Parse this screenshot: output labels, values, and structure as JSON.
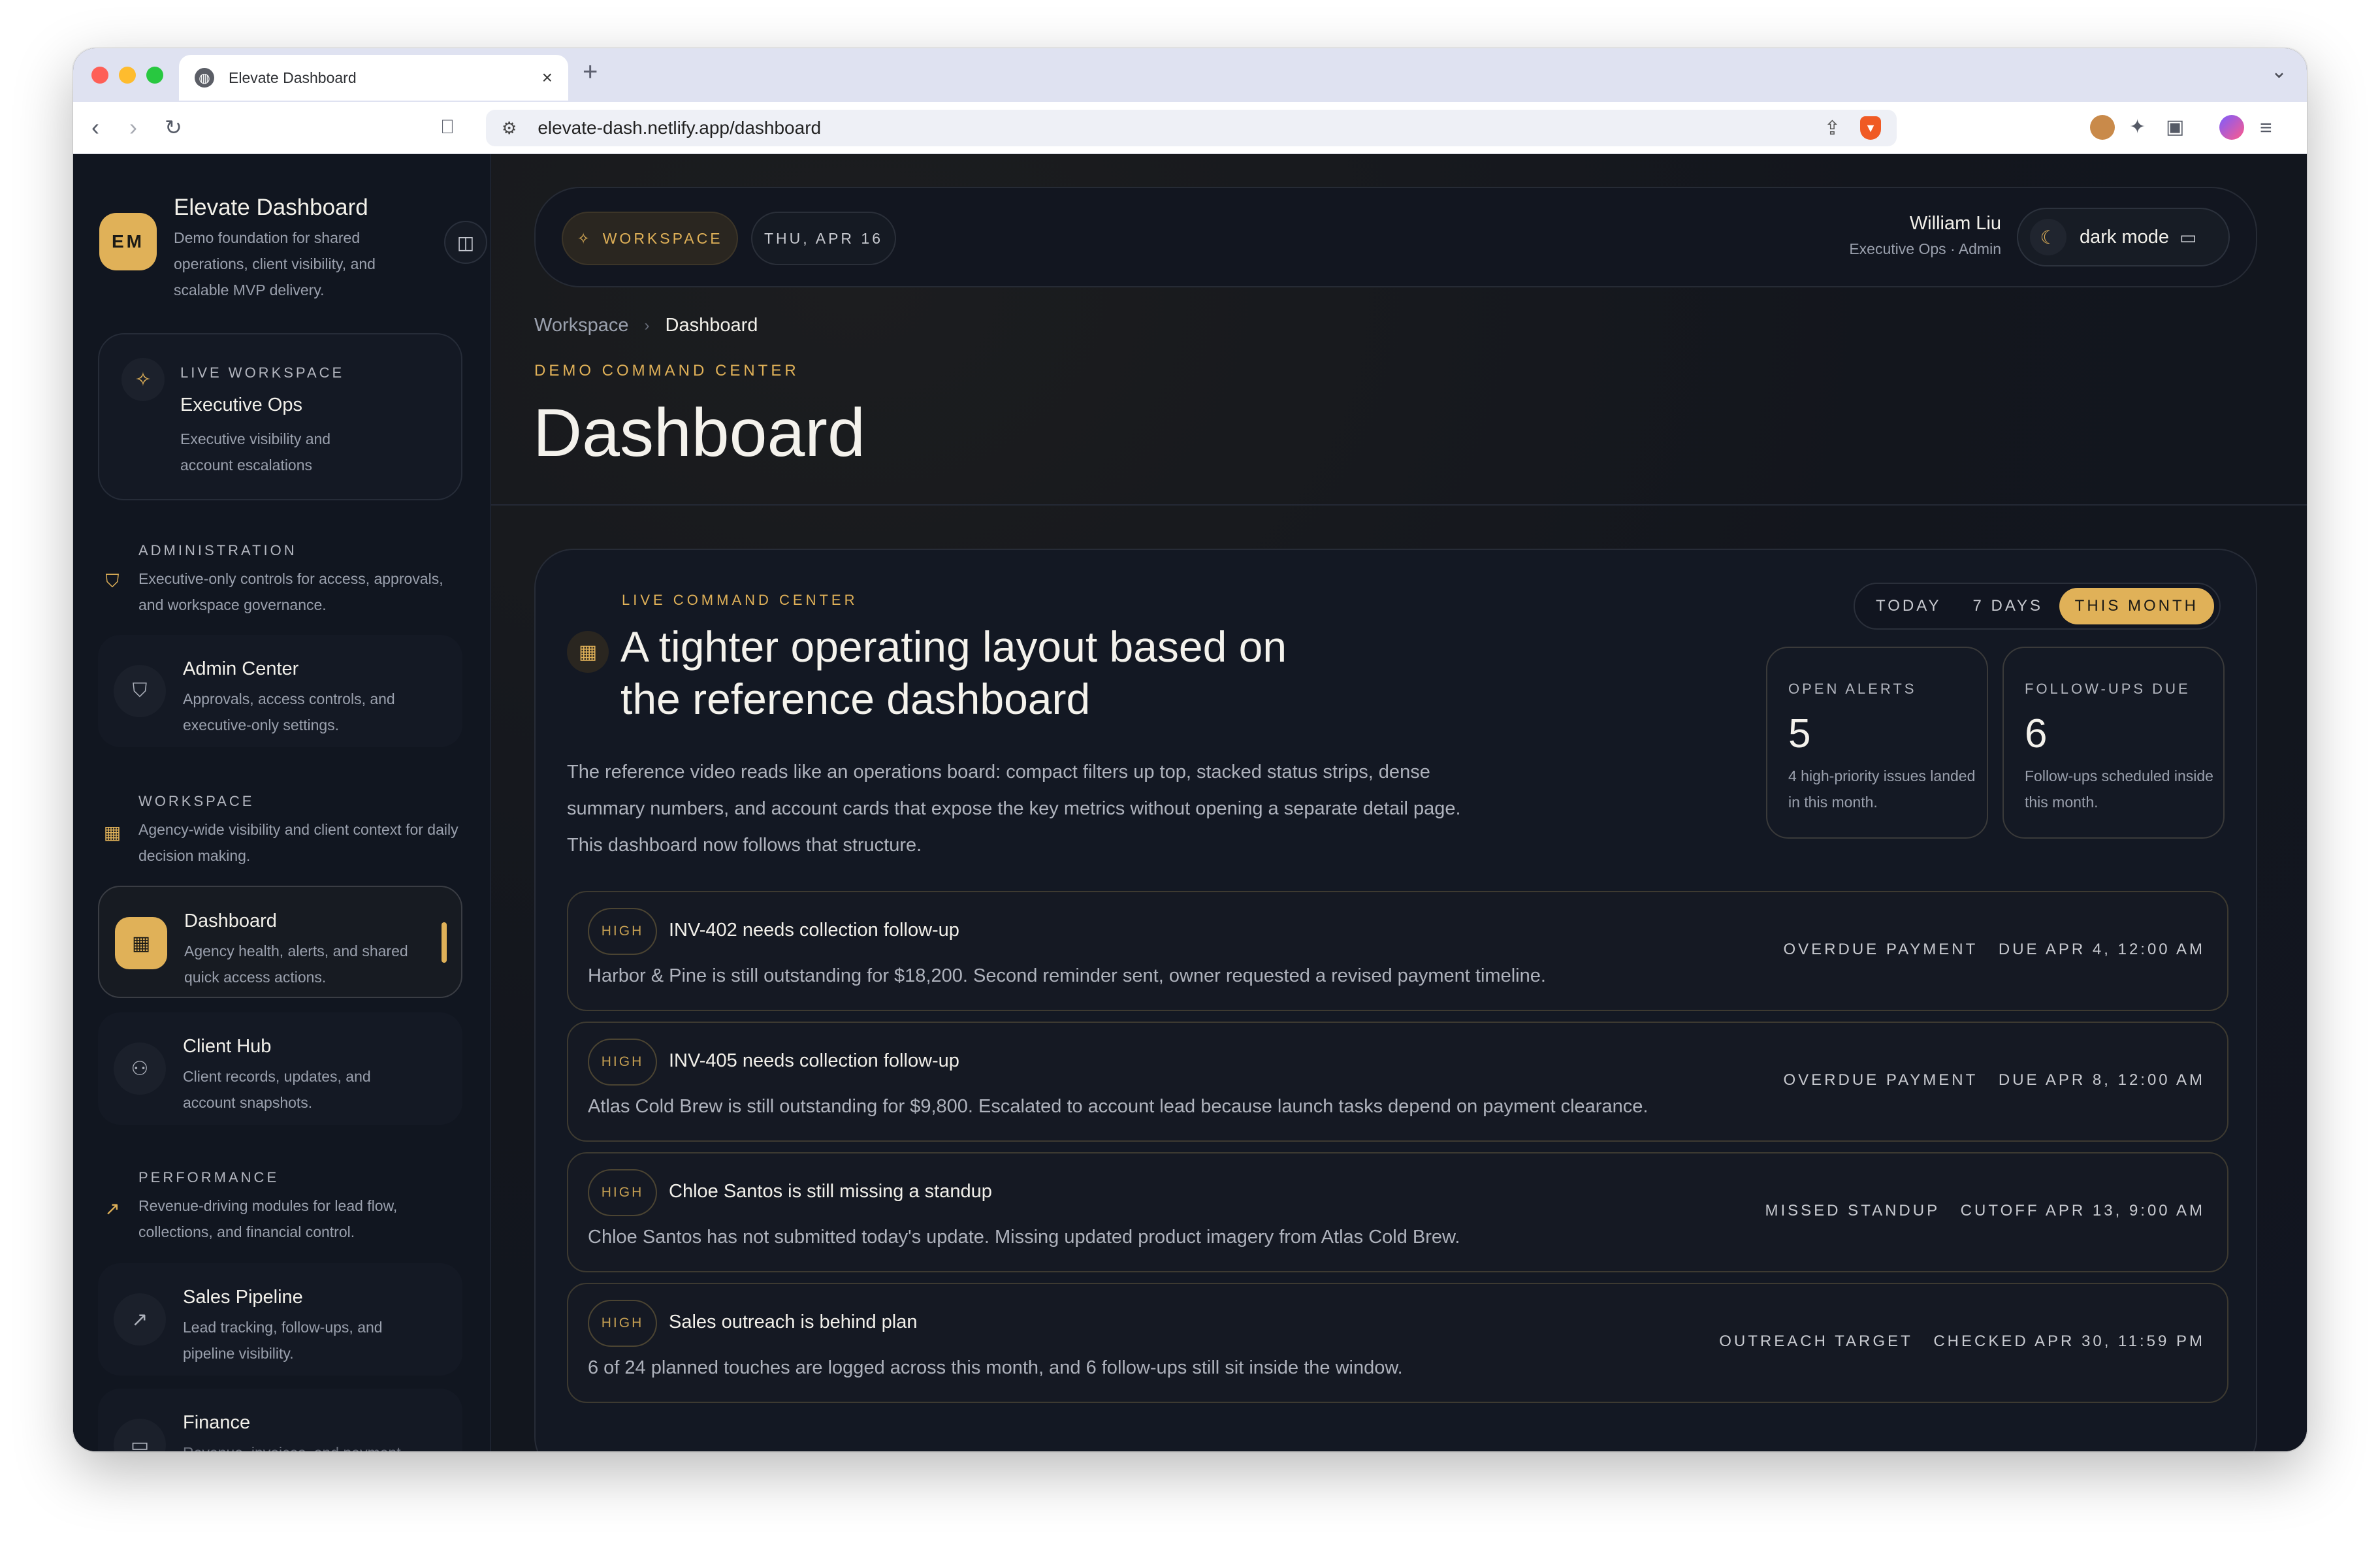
{
  "browser": {
    "tab_title": "Elevate Dashboard",
    "url": "elevate-dash.netlify.app/dashboard"
  },
  "sidebar": {
    "brand": {
      "initials": "EM",
      "name": "Elevate Dashboard",
      "description": "Demo foundation for shared operations, client visibility, and scalable MVP delivery."
    },
    "live_workspace": {
      "kicker": "LIVE WORKSPACE",
      "title": "Executive Ops",
      "subtitle": "Executive visibility and account escalations"
    },
    "sections": [
      {
        "kicker": "ADMINISTRATION",
        "description": "Executive-only controls for access, approvals, and workspace governance.",
        "icon": "shield-icon"
      },
      {
        "kicker": "WORKSPACE",
        "description": "Agency-wide visibility and client context for daily decision making.",
        "icon": "grid-icon"
      },
      {
        "kicker": "PERFORMANCE",
        "description": "Revenue-driving modules for lead flow, collections, and financial control.",
        "icon": "trend-icon"
      }
    ],
    "items": [
      {
        "title": "Admin Center",
        "subtitle": "Approvals, access controls, and executive-only settings.",
        "icon": "shield-icon"
      },
      {
        "title": "Dashboard",
        "subtitle": "Agency health, alerts, and shared quick access actions.",
        "icon": "grid-icon",
        "active": true
      },
      {
        "title": "Client Hub",
        "subtitle": "Client records, updates, and account snapshots.",
        "icon": "users-icon"
      },
      {
        "title": "Sales Pipeline",
        "subtitle": "Lead tracking, follow-ups, and pipeline visibility.",
        "icon": "trend-icon"
      },
      {
        "title": "Finance",
        "subtitle": "Revenue, invoices, and payment",
        "icon": "wallet-icon"
      }
    ]
  },
  "header": {
    "workspace_label": "WORKSPACE",
    "date_label": "THU, APR 16",
    "user_name": "William Liu",
    "user_role": "Executive Ops · Admin",
    "theme_label": "dark mode"
  },
  "breadcrumb": {
    "parent": "Workspace",
    "current": "Dashboard"
  },
  "page": {
    "kicker": "DEMO COMMAND CENTER",
    "title": "Dashboard"
  },
  "command_center": {
    "kicker": "LIVE COMMAND CENTER",
    "title": "A tighter operating layout based on the reference dashboard",
    "description": "The reference video reads like an operations board: compact filters up top, stacked status strips, dense summary numbers, and account cards that expose the key metrics without opening a separate detail page. This dashboard now follows that structure.",
    "ranges": [
      "TODAY",
      "7 DAYS",
      "THIS MONTH"
    ],
    "selected_range": "THIS MONTH",
    "stats": [
      {
        "label": "OPEN ALERTS",
        "value": "5",
        "note": "4 high-priority issues landed in this month."
      },
      {
        "label": "FOLLOW-UPS DUE",
        "value": "6",
        "note": "Follow-ups scheduled inside this month."
      }
    ],
    "alerts": [
      {
        "priority": "HIGH",
        "title": "INV-402 needs collection follow-up",
        "description": "Harbor & Pine is still outstanding for $18,200. Second reminder sent, owner requested a revised payment timeline.",
        "category": "OVERDUE PAYMENT",
        "when": "DUE APR 4, 12:00 AM"
      },
      {
        "priority": "HIGH",
        "title": "INV-405 needs collection follow-up",
        "description": "Atlas Cold Brew is still outstanding for $9,800. Escalated to account lead because launch tasks depend on payment clearance.",
        "category": "OVERDUE PAYMENT",
        "when": "DUE APR 8, 12:00 AM"
      },
      {
        "priority": "HIGH",
        "title": "Chloe Santos is still missing a standup",
        "description": "Chloe Santos has not submitted today's update. Missing updated product imagery from Atlas Cold Brew.",
        "category": "MISSED STANDUP",
        "when": "CUTOFF APR 13, 9:00 AM"
      },
      {
        "priority": "HIGH",
        "title": "Sales outreach is behind plan",
        "description": "6 of 24 planned touches are logged across this month, and 6 follow-ups still sit inside the window.",
        "category": "OUTREACH TARGET",
        "when": "CHECKED APR 30, 11:59 PM"
      }
    ]
  },
  "colors": {
    "accent": "#e0b158",
    "background": "#111520",
    "card": "#141924"
  }
}
